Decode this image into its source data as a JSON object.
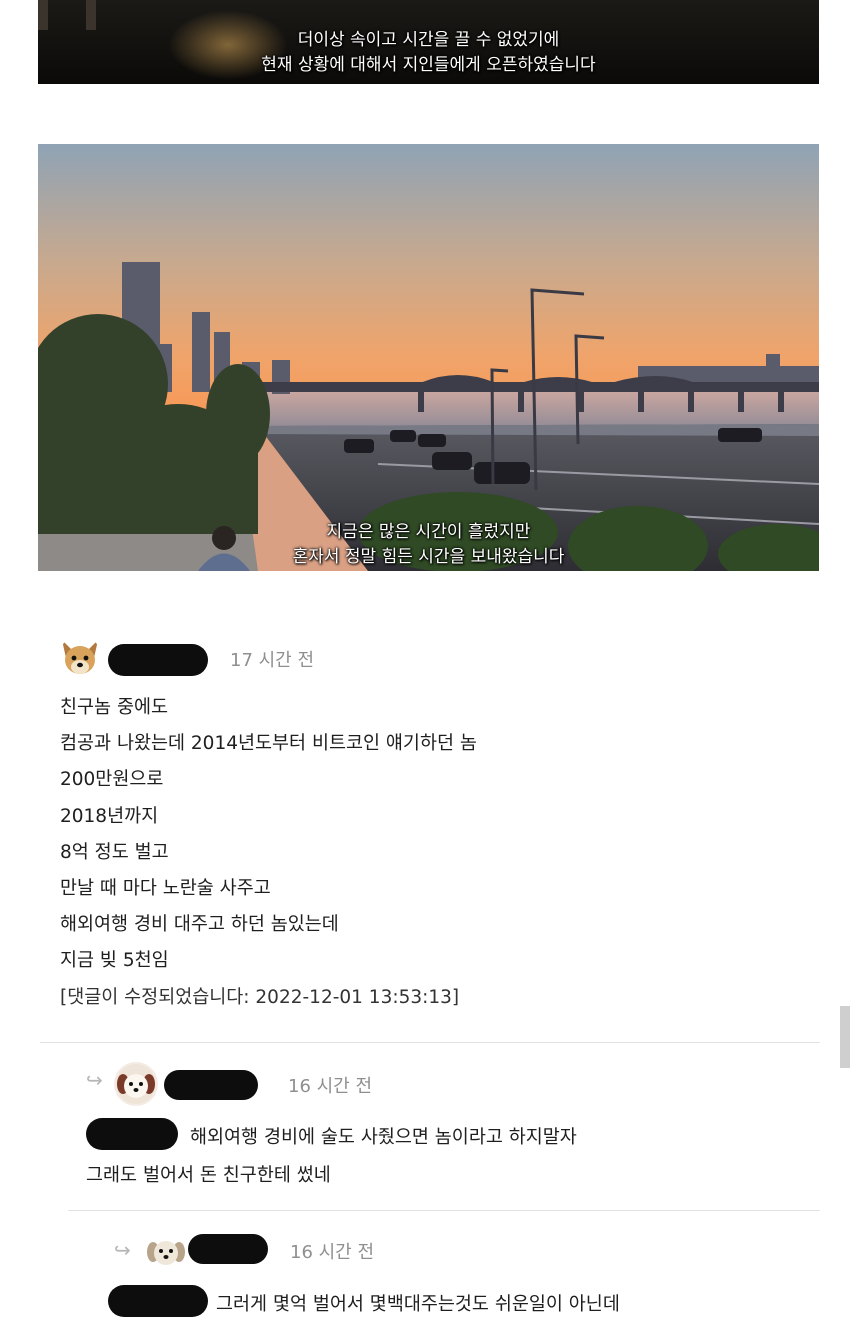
{
  "video_top": {
    "subtitle_lines": [
      "더이상 속이고 시간을 끌 수 없었기에",
      "현재 상황에 대해서 지인들에게 오픈하였습니다"
    ]
  },
  "video_main": {
    "subtitle_lines": [
      "지금은 많은 시간이 흘렀지만",
      "혼자서 정말 힘든 시간을 보내왔습니다"
    ]
  },
  "comment": {
    "avatar_icon": "dog-avatar-icon",
    "time": "17 시간 전",
    "lines": [
      "친구놈 중에도",
      "컴공과 나왔는데 2014년도부터 비트코인 얘기하던 놈",
      "200만원으로",
      "2018년까지",
      "8억 정도 벌고",
      "만날 때 마다 노란술 사주고",
      "해외여행 경비 대주고 하던 놈있는데",
      "지금 빚 5천임"
    ],
    "edited_note": "[댓글이 수정되었습니다: 2022-12-01 13:53:13]"
  },
  "reply1": {
    "arrow_icon": "reply-arrow-icon",
    "avatar_icon": "puppy-avatar-icon",
    "time": "16 시간 전",
    "line1": "해외여행 경비에 술도 사줬으면 놈이라고 하지말자",
    "line2": "그래도 벌어서 돈 친구한테 썼네"
  },
  "reply2": {
    "arrow_icon": "reply-arrow-icon",
    "avatar_icon": "puppy-avatar-icon",
    "time": "16 시간 전",
    "line1": "그러게 몇억 벌어서 몇백대주는것도 쉬운일이 아닌데"
  }
}
